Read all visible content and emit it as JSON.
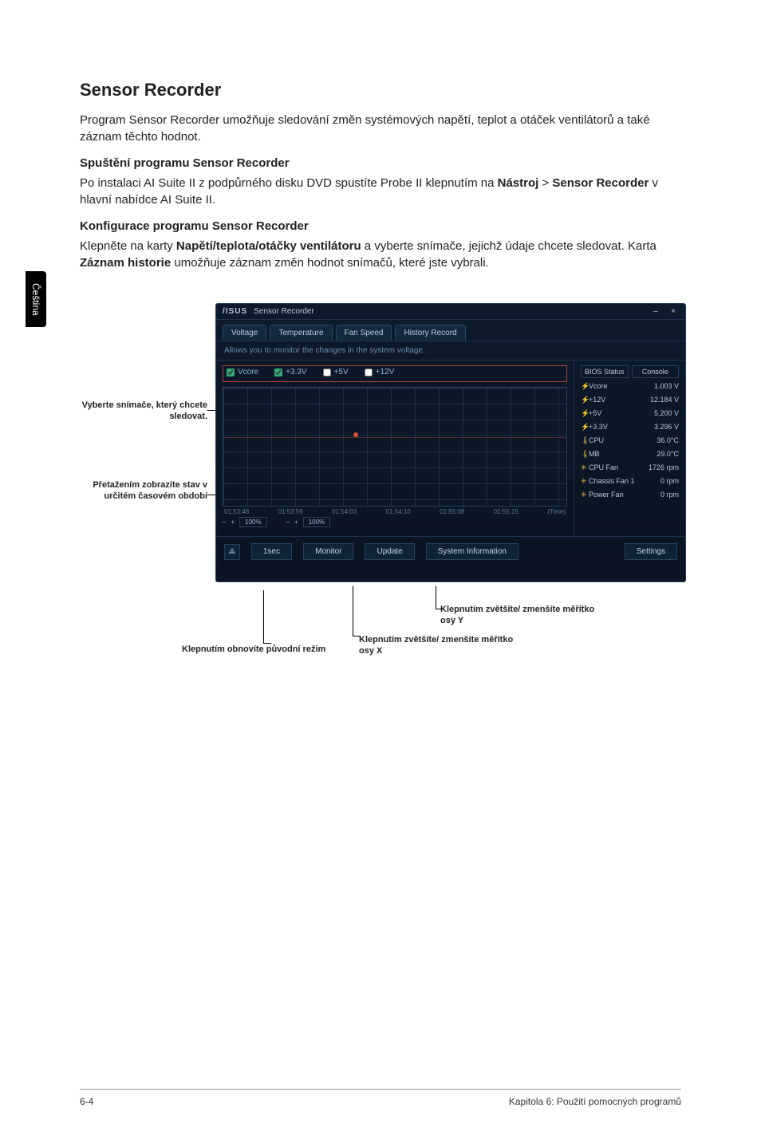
{
  "sideTab": "Čeština",
  "title": "Sensor Recorder",
  "intro": "Program Sensor Recorder umožňuje sledování změn systémových napětí, teplot a otáček ventilátorů a také záznam těchto hodnot.",
  "sub1": "Spuštění programu Sensor Recorder",
  "p1_a": "Po instalaci AI Suite II z podpůrného disku DVD spustíte Probe II klepnutím na ",
  "p1_tool": "Nástroj",
  "p1_gt": " > ",
  "p1_sr": "Sensor Recorder",
  "p1_b": " v hlavní nabídce AI Suite II.",
  "sub2": "Konfigurace programu Sensor Recorder",
  "p2_a": "Klepněte na karty ",
  "p2_bold1": "Napětí/teplota/otáčky ventilátoru",
  "p2_b": " a vyberte snímače, jejichž údaje chcete sledovat. Karta ",
  "p2_bold2": "Záznam historie",
  "p2_c": " umožňuje záznam změn hodnot snímačů, které jste vybrali.",
  "callouts": {
    "left1": "Vyberte snímače, který chcete sledovat.",
    "left2": "Přetažením zobrazíte stav v určitém časovém období",
    "bottomL": "Klepnutím obnovíte původní režim",
    "bottomM": "Klepnutím zvětšíte/ zmenšíte měřítko osy X",
    "bottomR": "Klepnutím zvětšíte/ zmenšíte měřítko osy Y"
  },
  "shot": {
    "logo": "/ISUS",
    "winTitle": "Sensor Recorder",
    "minimize": "–",
    "close": "×",
    "tabs": [
      "Voltage",
      "Temperature",
      "Fan Speed",
      "History Record"
    ],
    "hint": "Allows you to monitor the changes in the system voltage.",
    "checks": [
      "Vcore",
      "+3.3V",
      "+5V",
      "+12V"
    ],
    "axis": [
      "01:53:48",
      "01:53:56",
      "01:54:03",
      "01:54:10",
      "01:55:08",
      "01:55:15"
    ],
    "axisEnd": "(Time)",
    "zoomX": "100%",
    "zoomY": "100%",
    "sideHdr": [
      "BIOS Status",
      "Console"
    ],
    "sideRows": [
      {
        "ic": "⚡",
        "k": "Vcore",
        "v": "1.003 V"
      },
      {
        "ic": "⚡",
        "k": "+12V",
        "v": "12.184 V"
      },
      {
        "ic": "⚡",
        "k": "+5V",
        "v": "5.200 V"
      },
      {
        "ic": "⚡",
        "k": "+3.3V",
        "v": "3.296 V"
      },
      {
        "ic": "🌡",
        "k": "CPU",
        "v": "36.0°C"
      },
      {
        "ic": "🌡",
        "k": "MB",
        "v": "29.0°C"
      },
      {
        "ic": "✳",
        "k": "CPU Fan",
        "v": "1726 rpm"
      },
      {
        "ic": "✳",
        "k": "Chassis Fan 1",
        "v": "0 rpm"
      },
      {
        "ic": "✳",
        "k": "Power Fan",
        "v": "0 rpm"
      }
    ],
    "footer": {
      "reset": "1sec",
      "monitor": "Monitor",
      "update": "Update",
      "sysinfo": "System Information",
      "settings": "Settings"
    }
  },
  "footer": {
    "left": "6-4",
    "right": "Kapitola 6: Použití pomocných programů"
  }
}
